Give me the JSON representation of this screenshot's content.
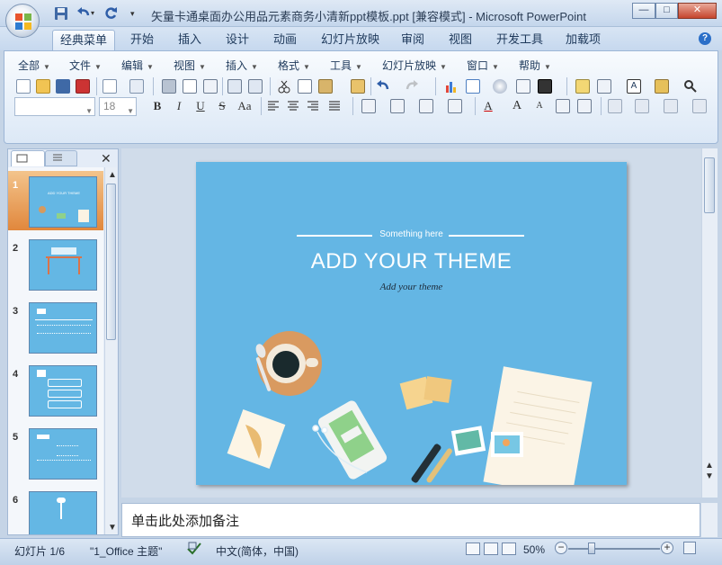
{
  "window": {
    "title": "矢量卡通桌面办公用品元素商务小清新ppt模板.ppt [兼容模式] - Microsoft PowerPoint",
    "min_label": "—",
    "max_label": "□",
    "close_label": "✕"
  },
  "tabs": [
    {
      "label": "经典菜单"
    },
    {
      "label": "开始"
    },
    {
      "label": "插入"
    },
    {
      "label": "设计"
    },
    {
      "label": "动画"
    },
    {
      "label": "幻灯片放映"
    },
    {
      "label": "审阅"
    },
    {
      "label": "视图"
    },
    {
      "label": "开发工具"
    },
    {
      "label": "加载项"
    }
  ],
  "help_label": "?",
  "menus": [
    {
      "label": "全部"
    },
    {
      "label": "文件"
    },
    {
      "label": "编辑"
    },
    {
      "label": "视图"
    },
    {
      "label": "插入"
    },
    {
      "label": "格式"
    },
    {
      "label": "工具"
    },
    {
      "label": "幻灯片放映"
    },
    {
      "label": "窗口"
    },
    {
      "label": "帮助"
    }
  ],
  "font": {
    "name_value": "",
    "size_value": "18"
  },
  "format_buttons": {
    "bold": "B",
    "italic": "I",
    "underline": "U",
    "strike": "S",
    "case": "Aa",
    "font_color": "A",
    "grow": "A",
    "shrink": "A"
  },
  "panel": {
    "close_label": "✕"
  },
  "thumbnails": [
    {
      "num": "1"
    },
    {
      "num": "2"
    },
    {
      "num": "3"
    },
    {
      "num": "4"
    },
    {
      "num": "5"
    },
    {
      "num": "6"
    }
  ],
  "slide": {
    "subtitle": "Something here",
    "title": "ADD YOUR THEME",
    "tagline": "Add your theme",
    "thumb_title": "ADD YOUR THEME",
    "background": "#64b6e4"
  },
  "notes": {
    "placeholder": "单击此处添加备注"
  },
  "status": {
    "slide_indicator": "幻灯片 1/6",
    "theme": "\"1_Office 主题\"",
    "language": "中文(简体，中国)",
    "zoom": "50%",
    "zoom_fraction": 0.5
  },
  "colors": {
    "accent": "#e1873c",
    "slide_bg": "#64b6e4"
  }
}
